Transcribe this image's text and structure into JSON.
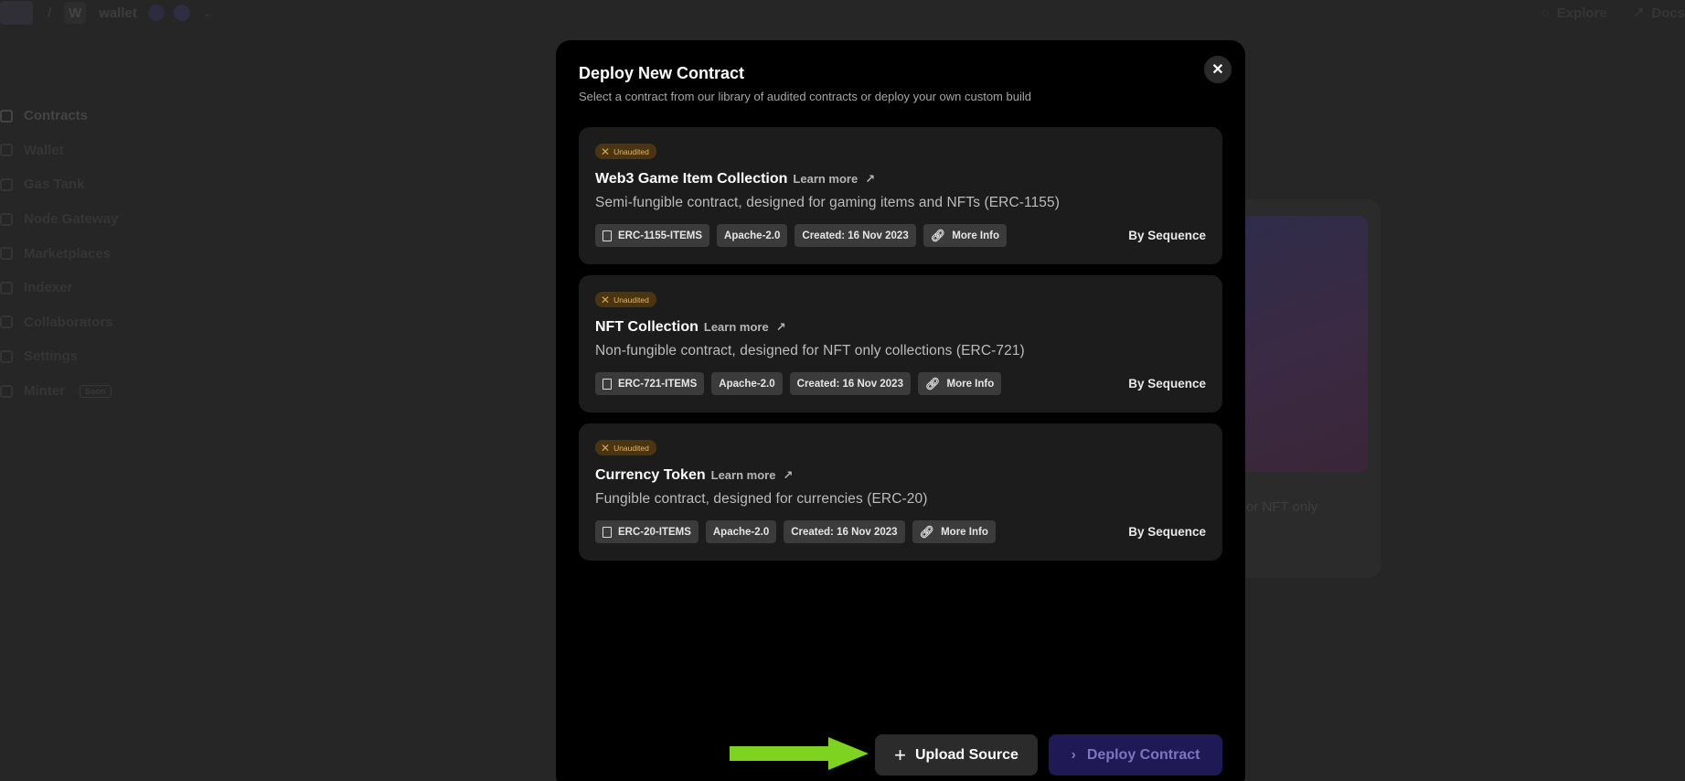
{
  "topbar": {
    "project_initial": "W",
    "project_name": "wallet",
    "crumb_separator": "/",
    "explore": "Explore",
    "docs": "Docs"
  },
  "sidebar": {
    "items": [
      {
        "label": "Contracts",
        "icon": "contracts-icon"
      },
      {
        "label": "Wallet",
        "icon": "wallet-icon"
      },
      {
        "label": "Gas Tank",
        "icon": "gas-tank-icon"
      },
      {
        "label": "Node Gateway",
        "icon": "node-gateway-icon"
      },
      {
        "label": "Marketplaces",
        "icon": "marketplaces-icon"
      },
      {
        "label": "Indexer",
        "icon": "indexer-icon"
      },
      {
        "label": "Collaborators",
        "icon": "collaborators-icon"
      },
      {
        "label": "Settings",
        "icon": "settings-icon"
      },
      {
        "label": "Minter",
        "icon": "minter-icon",
        "badge": "Soon"
      }
    ]
  },
  "background_card": {
    "partial_text": "or NFT only"
  },
  "modal": {
    "title": "Deploy New Contract",
    "subtitle": "Select a contract from our library of audited contracts or deploy your own custom build",
    "close_icon": "close-icon",
    "contracts": [
      {
        "badge": "Unaudited",
        "name": "Web3 Game Item Collection",
        "learn_more": "Learn more",
        "description": "Semi-fungible contract, designed for gaming items and NFTs (ERC-1155)",
        "chips": {
          "source": "ERC-1155-ITEMS",
          "license": "Apache-2.0",
          "created": "Created: 16 Nov 2023",
          "more_info": "More Info"
        },
        "author": "By Sequence"
      },
      {
        "badge": "Unaudited",
        "name": "NFT Collection",
        "learn_more": "Learn more",
        "description": "Non-fungible contract, designed for NFT only collections (ERC-721)",
        "chips": {
          "source": "ERC-721-ITEMS",
          "license": "Apache-2.0",
          "created": "Created: 16 Nov 2023",
          "more_info": "More Info"
        },
        "author": "By Sequence"
      },
      {
        "badge": "Unaudited",
        "name": "Currency Token",
        "learn_more": "Learn more",
        "description": "Fungible contract, designed for currencies (ERC-20)",
        "chips": {
          "source": "ERC-20-ITEMS",
          "license": "Apache-2.0",
          "created": "Created: 16 Nov 2023",
          "more_info": "More Info"
        },
        "author": "By Sequence"
      }
    ],
    "upload_button": "Upload Source",
    "deploy_button": "Deploy Contract"
  },
  "colors": {
    "backdrop": "#262626",
    "modal_bg": "#000000",
    "card_bg": "#1c1c1c",
    "badge_bg": "#4a3510",
    "badge_text": "#e2b56a",
    "deploy_bg": "#1f1a56",
    "arrow": "#7ed321"
  }
}
